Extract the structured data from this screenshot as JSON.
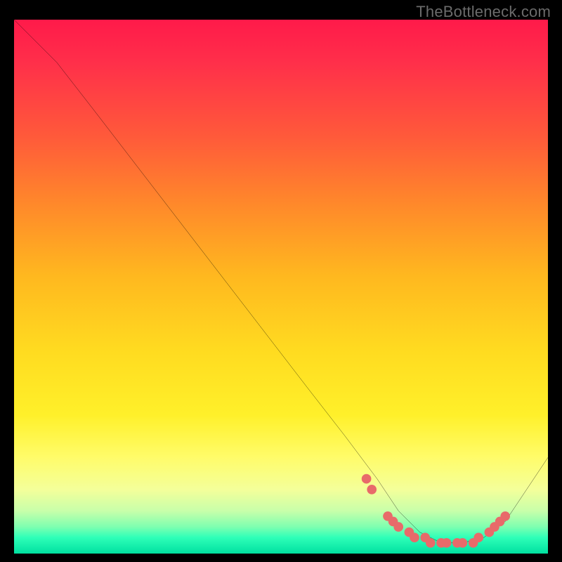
{
  "watermark": "TheBottleneck.com",
  "chart_data": {
    "type": "line",
    "title": "",
    "xlabel": "",
    "ylabel": "",
    "xlim": [
      0,
      100
    ],
    "ylim": [
      0,
      100
    ],
    "grid": false,
    "legend": false,
    "background_heatmap": {
      "axis": "y",
      "description": "vertical gradient, red (high y) through yellow to green (low y)",
      "stops": [
        {
          "y": 100,
          "color": "#ff1a4a"
        },
        {
          "y": 60,
          "color": "#ff8a2a"
        },
        {
          "y": 30,
          "color": "#fff02a"
        },
        {
          "y": 5,
          "color": "#7effb0"
        },
        {
          "y": 0,
          "color": "#00e0a0"
        }
      ]
    },
    "series": [
      {
        "name": "bottleneck-curve",
        "color": "#000000",
        "x": [
          0,
          8,
          15,
          25,
          35,
          45,
          55,
          62,
          68,
          72,
          76,
          80,
          84,
          88,
          92,
          100
        ],
        "y": [
          100,
          92,
          83,
          70,
          57,
          44,
          31,
          22,
          14,
          8,
          4,
          2,
          2,
          3,
          6,
          18
        ]
      }
    ],
    "markers": {
      "name": "optimal-zone-points",
      "color": "#e86a6a",
      "points": [
        {
          "x": 66,
          "y": 14
        },
        {
          "x": 67,
          "y": 12
        },
        {
          "x": 70,
          "y": 7
        },
        {
          "x": 71,
          "y": 6
        },
        {
          "x": 72,
          "y": 5
        },
        {
          "x": 74,
          "y": 4
        },
        {
          "x": 75,
          "y": 3
        },
        {
          "x": 77,
          "y": 3
        },
        {
          "x": 78,
          "y": 2
        },
        {
          "x": 80,
          "y": 2
        },
        {
          "x": 81,
          "y": 2
        },
        {
          "x": 83,
          "y": 2
        },
        {
          "x": 84,
          "y": 2
        },
        {
          "x": 86,
          "y": 2
        },
        {
          "x": 87,
          "y": 3
        },
        {
          "x": 89,
          "y": 4
        },
        {
          "x": 90,
          "y": 5
        },
        {
          "x": 91,
          "y": 6
        },
        {
          "x": 92,
          "y": 7
        }
      ]
    }
  }
}
